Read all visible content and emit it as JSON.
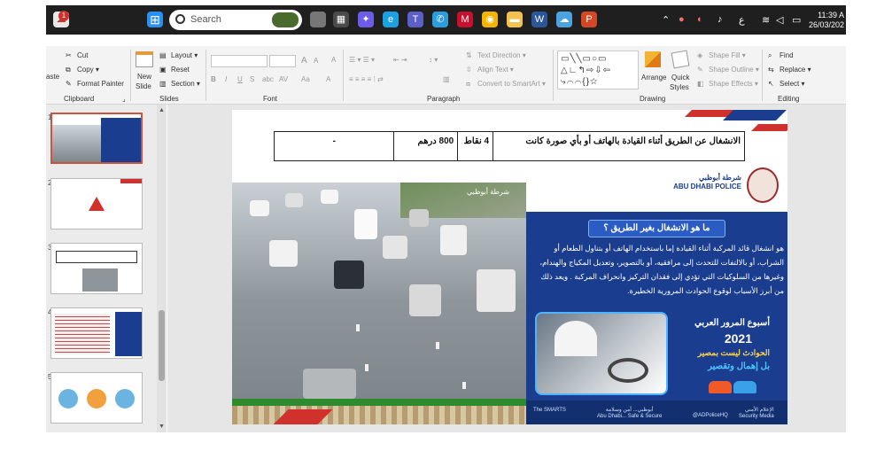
{
  "taskbar": {
    "notification_count": "1",
    "search_placeholder": "Search",
    "clock_time": "11:39 A",
    "clock_date": "26/03/202",
    "lang": "ع"
  },
  "ribbon": {
    "clipboard": {
      "paste": "aste",
      "cut": "Cut",
      "copy": "Copy",
      "format_painter": "Format Painter",
      "label": "Clipboard"
    },
    "slides": {
      "new_slide_1": "New",
      "new_slide_2": "Slide",
      "layout": "Layout",
      "reset": "Reset",
      "section": "Section",
      "label": "Slides"
    },
    "font": {
      "label": "Font",
      "bold": "B",
      "italic": "I",
      "underline": "U",
      "strike": "S",
      "abc": "abc",
      "av": "AV",
      "aa": "Aa",
      "a": "A",
      "grow": "A",
      "shrink": "A"
    },
    "paragraph": {
      "label": "Paragraph",
      "text_direction": "Text Direction",
      "align_text": "Align Text",
      "smartart": "Convert to SmartArt"
    },
    "drawing": {
      "label": "Drawing",
      "arrange": "Arrange",
      "quick_styles_1": "Quick",
      "quick_styles_2": "Styles",
      "shape_fill": "Shape Fill",
      "shape_outline": "Shape Outline",
      "shape_effects": "Shape Effects"
    },
    "editing": {
      "label": "Editing",
      "find": "Find",
      "replace": "Replace",
      "select": "Select"
    }
  },
  "thumbnails": [
    "1",
    "2",
    "3",
    "4",
    "5"
  ],
  "slide": {
    "table": {
      "violation": "الانشغال عن الطريق أثناء القيادة بالهاتف أو بأي صورة كانت",
      "points": "4 نقاط",
      "fine": "800 درهم",
      "impound": "-"
    },
    "logo_text_ar": "شرطة أبوظبي",
    "logo_text_en": "ABU DHABI POLICE",
    "question": "ما هو الانشغال بغير الطريق ؟",
    "body": "هو انشغال قائد المركبة أثناء القيادة إما باستخدام الهاتف أو بتناول الطعام أو الشراب، أو بالالتفات للتحدث إلى مرافقيه، أو بالتصوير، وتعديل المكياج والهندام، وغيرها من السلوكيات التي تؤدي إلى فقدان التركيز وانحراف المركبة . ويعد ذلك من أبرز الأسباب لوقوع الحوادث المرورية الخطيرة.",
    "week_title": "أسبوع المرور العربي",
    "week_year": "2021",
    "week_slogan_1": "الحوادث ليست بمصير",
    "week_slogan_2": "بل إهمال وتقصير",
    "footer_1": "أبوظبي... أمن وسلامة",
    "footer_1_en": "Abu Dhabi... Safe & Secure",
    "footer_2": "الإعلام الأمني",
    "footer_2_en": "Security Media",
    "footer_3": "@ADPoliceHQ",
    "footer_4": "The SMARTS",
    "photo_caption": "شرطة أبوظبي"
  },
  "colors": {
    "accent_red": "#c8553d",
    "panel_blue": "#1a3d8f"
  }
}
